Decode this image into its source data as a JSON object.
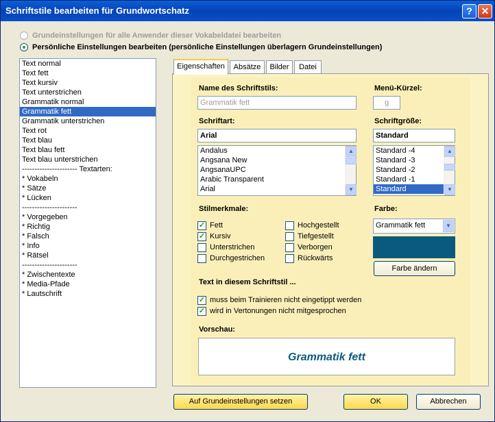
{
  "window": {
    "title": "Schriftstile bearbeiten für Grundwortschatz",
    "help_label": "?",
    "close_label": "✕"
  },
  "radios": [
    {
      "label": "Grundeinstellungen für alle Anwender dieser Vokabeldatei bearbeiten",
      "checked": false,
      "enabled": false
    },
    {
      "label": "Persönliche Einstellungen bearbeiten (persönliche Einstellungen überlagern Grundeinstellungen)",
      "checked": true,
      "enabled": true
    }
  ],
  "style_list": [
    "Text normal",
    "Text fett",
    "Text kursiv",
    "Text unterstrichen",
    "Grammatik normal",
    "Grammatik fett",
    "Grammatik unterstrichen",
    "Text rot",
    "Text blau",
    "Text blau fett",
    "Text blau unterstrichen",
    "---------------------- Textarten:",
    "* Vokabeln",
    "* Sätze",
    "* Lücken",
    "----------------------",
    "* Vorgegeben",
    "* Richtig",
    "* Falsch",
    "* Info",
    "* Rätsel",
    "----------------------",
    "* Zwischentexte",
    "* Media-Pfade",
    "* Lautschrift"
  ],
  "selected_style_index": 5,
  "tabs": [
    "Eigenschaften",
    "Absätze",
    "Bilder",
    "Datei"
  ],
  "properties": {
    "name_label": "Name des Schriftstils:",
    "name_value": "Grammatik fett",
    "shortcut_label": "Menü-Kürzel:",
    "shortcut_value": "g",
    "font_label": "Schriftart:",
    "font_value": "Arial",
    "font_options": [
      "Andalus",
      "Angsana New",
      "AngsanaUPC",
      "Arabic Transparent",
      "Arial"
    ],
    "size_label": "Schriftgröße:",
    "size_value": "Standard",
    "size_options": [
      "Standard -4",
      "Standard -3",
      "Standard -2",
      "Standard -1",
      "Standard"
    ],
    "stil_label": "Stilmerkmale:",
    "styles_left": [
      {
        "label": "Fett",
        "checked": true
      },
      {
        "label": "Kursiv",
        "checked": true
      },
      {
        "label": "Unterstrichen",
        "checked": false
      },
      {
        "label": "Durchgestrichen",
        "checked": false
      }
    ],
    "styles_right": [
      {
        "label": "Hochgestellt",
        "checked": false
      },
      {
        "label": "Tiefgestellt",
        "checked": false
      },
      {
        "label": "Verborgen",
        "checked": false
      },
      {
        "label": "Rückwärts",
        "checked": false
      }
    ],
    "color_label": "Farbe:",
    "color_value": "Grammatik fett",
    "color_hex": "#0a5a7e",
    "change_color_label": "Farbe ändern",
    "text_style_label": "Text in diesem Schriftstil ...",
    "text_options": [
      {
        "label": "muss beim Trainieren nicht eingetippt werden",
        "checked": true
      },
      {
        "label": "wird in Vertonungen nicht mitgesprochen",
        "checked": true
      }
    ],
    "preview_label": "Vorschau:",
    "preview_text": "Grammatik fett"
  },
  "buttons": {
    "reset": "Auf Grundeinstellungen setzen",
    "ok": "OK",
    "cancel": "Abbrechen"
  },
  "colors": {
    "preview_text": "#0a5a7e",
    "selection": "#316ac5",
    "panel": "#fbefb9"
  }
}
